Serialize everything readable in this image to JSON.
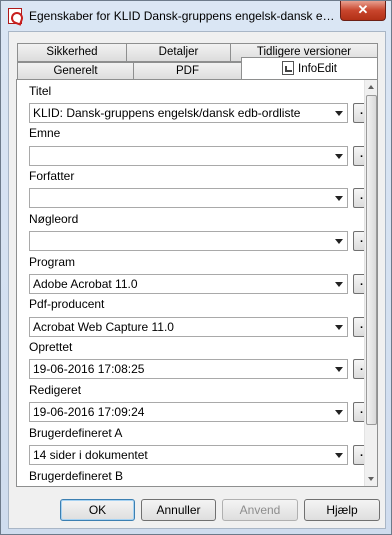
{
  "window": {
    "title": "Egenskaber for KLID Dansk-gruppens engelsk-dansk edb-ordliste",
    "close_label": "✕"
  },
  "tabs": {
    "row1": [
      {
        "label": "Sikkerhed"
      },
      {
        "label": "Detaljer"
      },
      {
        "label": "Tidligere versioner"
      }
    ],
    "row2": [
      {
        "label": "Generelt"
      },
      {
        "label": "PDF"
      },
      {
        "label": "InfoEdit",
        "active": true
      }
    ]
  },
  "fields": [
    {
      "label": "Titel",
      "value": "KLID: Dansk-gruppens engelsk/dansk edb-ordliste"
    },
    {
      "label": "Emne",
      "value": ""
    },
    {
      "label": "Forfatter",
      "value": ""
    },
    {
      "label": "Nøgleord",
      "value": ""
    },
    {
      "label": "Program",
      "value": "Adobe Acrobat 11.0"
    },
    {
      "label": "Pdf-producent",
      "value": "Acrobat Web Capture 11.0"
    },
    {
      "label": "Oprettet",
      "value": "19-06-2016 17:08:25"
    },
    {
      "label": "Redigeret",
      "value": "19-06-2016 17:09:24"
    },
    {
      "label": "Brugerdefineret A",
      "value": "14 sider i dokumentet"
    },
    {
      "label": "Brugerdefineret B",
      "value": ""
    }
  ],
  "dot_button_label": ".",
  "buttons": {
    "ok": "OK",
    "cancel": "Annuller",
    "apply": "Anvend",
    "help": "Hjælp"
  }
}
